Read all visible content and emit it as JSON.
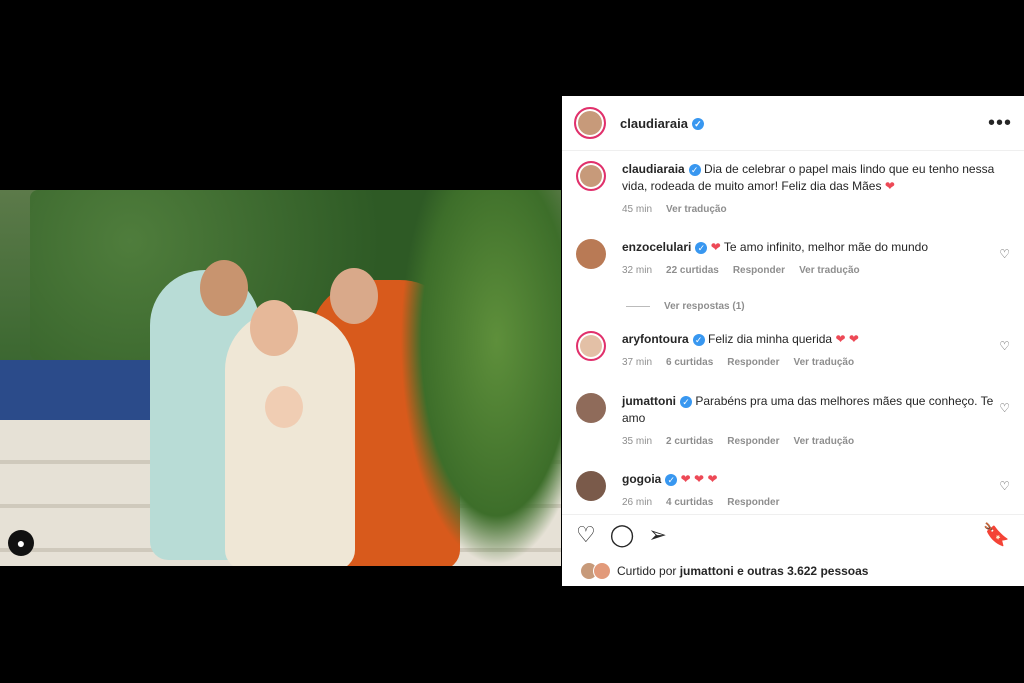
{
  "post": {
    "username": "claudiaraia",
    "verified_mark": "✓",
    "more_icon": "•••"
  },
  "caption": {
    "username": "claudiaraia",
    "text": "Dia de celebrar o papel mais lindo que eu tenho nessa vida, rodeada de muito amor! Feliz dia das Mães",
    "emoji": "❤",
    "time": "45 min",
    "translate": "Ver tradução"
  },
  "comments": [
    {
      "username": "enzocelulari",
      "text": "Te amo infinito, melhor mãe do mundo",
      "emoji_before": "❤",
      "emoji_after": "",
      "time": "32 min",
      "likes": "22 curtidas",
      "reply": "Responder",
      "translate": "Ver tradução"
    },
    {
      "username": "aryfontoura",
      "text": "Feliz dia minha querida",
      "emoji_before": "",
      "emoji_after": "❤ ❤",
      "time": "37 min",
      "likes": "6 curtidas",
      "reply": "Responder",
      "translate": "Ver tradução"
    },
    {
      "username": "jumattoni",
      "text": "Parabéns pra uma das melhores mães que conheço. Te amo",
      "emoji_before": "",
      "emoji_after": "",
      "time": "35 min",
      "likes": "2 curtidas",
      "reply": "Responder",
      "translate": "Ver tradução"
    },
    {
      "username": "gogoia",
      "text": "",
      "emoji_before": "",
      "emoji_after": "❤ ❤ ❤",
      "time": "26 min",
      "likes": "4 curtidas",
      "reply": "Responder",
      "translate": ""
    }
  ],
  "replies_link": "Ver respostas (1)",
  "actions": {
    "like": "♡",
    "comment": "◯",
    "share": "➢",
    "save": "🔖"
  },
  "liked_by": {
    "prefix": "Curtido por",
    "user": "jumattoni",
    "suffix": "e outras 3.622 pessoas"
  },
  "photo_user_icon": "●"
}
